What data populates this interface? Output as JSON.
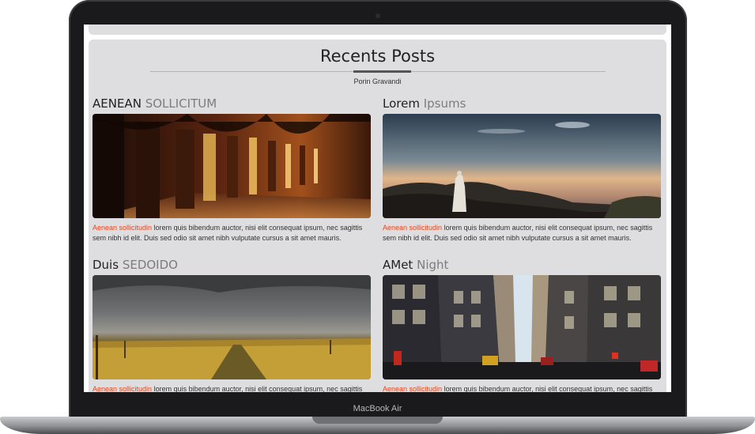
{
  "device": {
    "label": "MacBook Air"
  },
  "section": {
    "title": "Recents Posts",
    "subtitle": "Porin Gravandi"
  },
  "posts": [
    {
      "title_bold": "AENEAN",
      "title_rest": "SOLLICITUM",
      "image_icon": "monastery-corridor-photo",
      "link_text": "Aenean sollicitudin",
      "body": " lorem quis bibendum auctor, nisi elit consequat ipsum, nec sagittis sem nibh id elit. Duis sed odio sit amet nibh vulputate cursus a sit amet mauris."
    },
    {
      "title_bold": "Lorem",
      "title_rest": "Ipsums",
      "image_icon": "mountain-statue-photo",
      "link_text": "Aenean sollicitudin",
      "body": " lorem quis bibendum auctor, nisi elit consequat ipsum, nec sagittis sem nibh id elit. Duis sed odio sit amet nibh vulputate cursus a sit amet mauris."
    },
    {
      "title_bold": "Duis",
      "title_rest": "SEDOIDO",
      "image_icon": "wheat-field-photo",
      "link_text": "Aenean sollicitudin",
      "body": " lorem quis bibendum auctor, nisi elit consequat ipsum, nec sagittis"
    },
    {
      "title_bold": "AMet",
      "title_rest": "Night",
      "image_icon": "city-street-photo",
      "link_text": "Aenean sollicitudin",
      "body": " lorem quis bibendum auctor, nisi elit consequat ipsum, nec sagittis"
    }
  ],
  "colors": {
    "accent_link": "#e8461b",
    "panel": "#dedde0",
    "laptop_frame": "#1a1a1c"
  }
}
